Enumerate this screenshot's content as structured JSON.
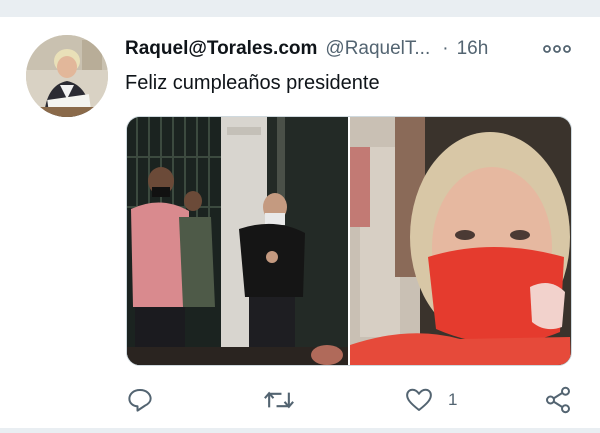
{
  "tweet": {
    "display_name": "Raquel@Torales.com",
    "handle": "@RaquelT...",
    "separator": "·",
    "time": "16h",
    "text": "Feliz cumpleaños presidente"
  },
  "actions": {
    "reply_icon": "reply-icon",
    "retweet_icon": "retweet-icon",
    "like_icon": "heart-icon",
    "like_count": "1",
    "share_icon": "share-icon"
  },
  "icons": {
    "more": "more-options-icon"
  },
  "colors": {
    "text_primary": "#0f1419",
    "text_secondary": "#536471",
    "divider": "#e9eef2",
    "mask_red": "#e53b2e"
  }
}
